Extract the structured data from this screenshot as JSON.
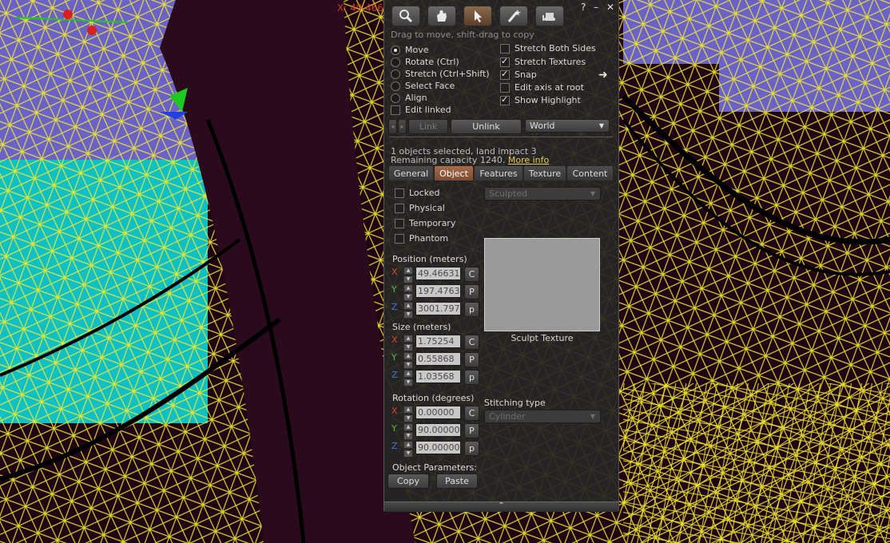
{
  "viewport": {
    "coord_readout": "X: 49.466"
  },
  "window": {
    "help": "?",
    "minimize": "–",
    "close": "✕"
  },
  "toolbar": {
    "buttons": [
      {
        "name": "focus-tool-button",
        "icon": "magnifier-icon"
      },
      {
        "name": "move-tool-button",
        "icon": "grab-hand-icon"
      },
      {
        "name": "edit-tool-button",
        "icon": "pointer-arrow-icon",
        "active": true
      },
      {
        "name": "create-tool-button",
        "icon": "magic-wand-icon"
      },
      {
        "name": "land-tool-button",
        "icon": "bulldozer-icon"
      }
    ],
    "hint": "Drag to move, shift-drag to copy"
  },
  "modes": [
    {
      "label": "Move",
      "selected": true
    },
    {
      "label": "Rotate (Ctrl)",
      "selected": false
    },
    {
      "label": "Stretch (Ctrl+Shift)",
      "selected": false
    },
    {
      "label": "Select Face",
      "selected": false
    },
    {
      "label": "Align",
      "selected": false
    }
  ],
  "edit_linked": {
    "label": "Edit linked",
    "checked": false
  },
  "options": [
    {
      "label": "Stretch Both Sides",
      "checked": false
    },
    {
      "label": "Stretch Textures",
      "checked": true
    },
    {
      "label": "Snap",
      "checked": true
    },
    {
      "label": "Edit axis at root",
      "checked": false
    },
    {
      "label": "Show Highlight",
      "checked": true
    }
  ],
  "link_row": {
    "link_label": "Link",
    "unlink_label": "Unlink",
    "ruler_value": "World"
  },
  "selection_info": {
    "line1": "1 objects selected, land impact 3",
    "line2": "Remaining capacity 1240.",
    "more_info": "More info"
  },
  "tabs": [
    {
      "label": "General",
      "active": false
    },
    {
      "label": "Object",
      "active": true
    },
    {
      "label": "Features",
      "active": false
    },
    {
      "label": "Texture",
      "active": false
    },
    {
      "label": "Content",
      "active": false
    }
  ],
  "object_flags": [
    {
      "label": "Locked",
      "checked": false
    },
    {
      "label": "Physical",
      "checked": false
    },
    {
      "label": "Temporary",
      "checked": false
    },
    {
      "label": "Phantom",
      "checked": false
    }
  ],
  "type_combo": "Sculpted",
  "position": {
    "label": "Position (meters)",
    "x": "49.46631",
    "y": "197.47639",
    "z": "3001.7971",
    "x_btn": "C",
    "y_btn": "P",
    "z_btn": "p"
  },
  "size": {
    "label": "Size (meters)",
    "x": "1.75254",
    "y": "0.55868",
    "z": "1.03568",
    "x_btn": "C",
    "y_btn": "P",
    "z_btn": "p"
  },
  "rotation": {
    "label": "Rotation (degrees)",
    "x": "0.00000",
    "y": "90.00000",
    "z": "90.00000",
    "x_btn": "C",
    "y_btn": "P",
    "z_btn": "p"
  },
  "axis_labels": {
    "x": "X",
    "y": "Y",
    "z": "Z"
  },
  "axis_colors": {
    "x": "#e0402c",
    "y": "#4cc82c",
    "z": "#3c78e0"
  },
  "sculpt_texture_label": "Sculpt Texture",
  "stitching": {
    "label": "Stitching type",
    "value": "Cylinder"
  },
  "object_params": {
    "label": "Object Parameters:",
    "copy_label": "Copy",
    "paste_label": "Paste"
  },
  "resize_handle": "⌃"
}
